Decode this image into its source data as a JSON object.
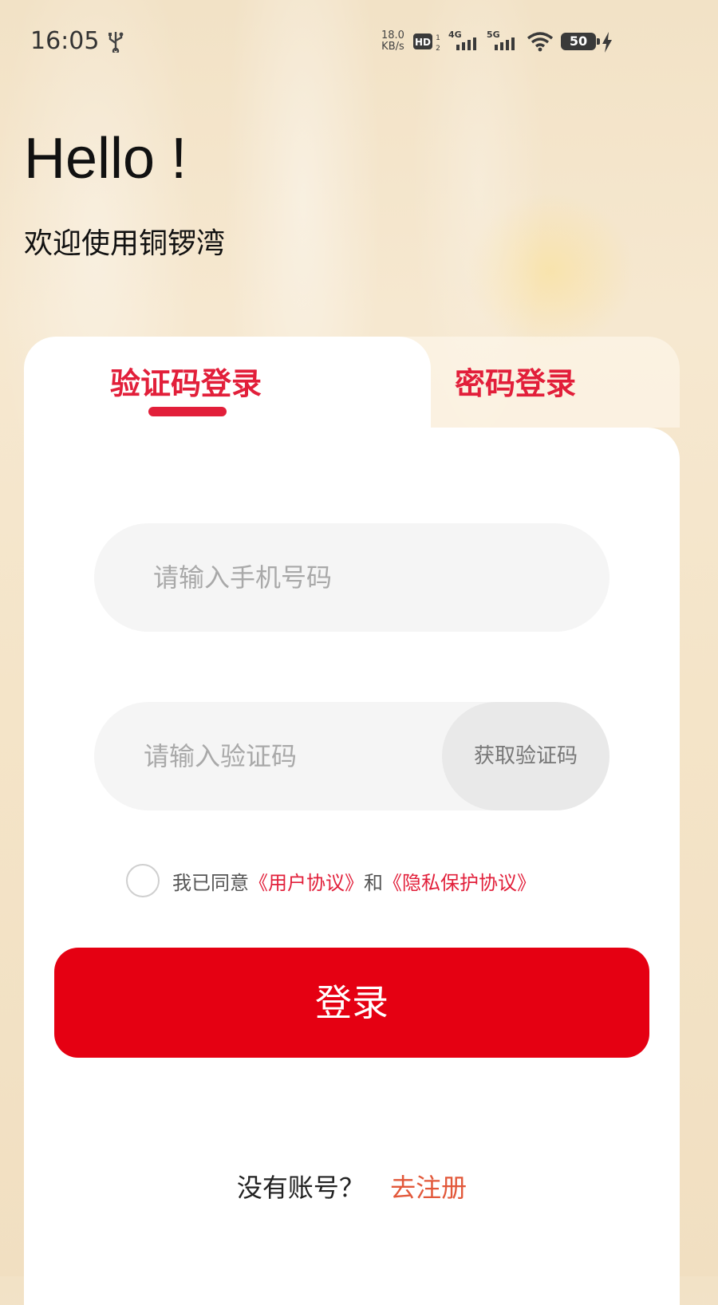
{
  "status_bar": {
    "time": "16:05",
    "net_speed_value": "18.0",
    "net_speed_unit": "KB/s",
    "hd_label": "HD",
    "sim1_label": "4G",
    "sim2_label": "5G",
    "battery_level": "50",
    "icons": [
      "usb-icon",
      "hd-icon",
      "signal-4g-icon",
      "signal-5g-icon",
      "wifi-icon",
      "battery-icon",
      "charging-bolt-icon"
    ]
  },
  "header": {
    "greeting": "Hello !",
    "welcome": "欢迎使用铜锣湾"
  },
  "tabs": [
    {
      "label": "验证码登录",
      "active": true
    },
    {
      "label": "密码登录",
      "active": false
    }
  ],
  "form": {
    "phone_placeholder": "请输入手机号码",
    "code_placeholder": "请输入验证码",
    "get_code_label": "获取验证码"
  },
  "agreement": {
    "prefix": "我已同意",
    "user_agreement": "《用户协议》",
    "conjunction": "和",
    "privacy_agreement": "《隐私保护协议》",
    "checked": false
  },
  "login_button_label": "登录",
  "register": {
    "prompt": "没有账号？",
    "link": "去注册"
  },
  "colors": {
    "accent": "#e21f3a",
    "login_button": "#e50012",
    "register_link": "#e2583a",
    "background": "#f4e4c8"
  }
}
